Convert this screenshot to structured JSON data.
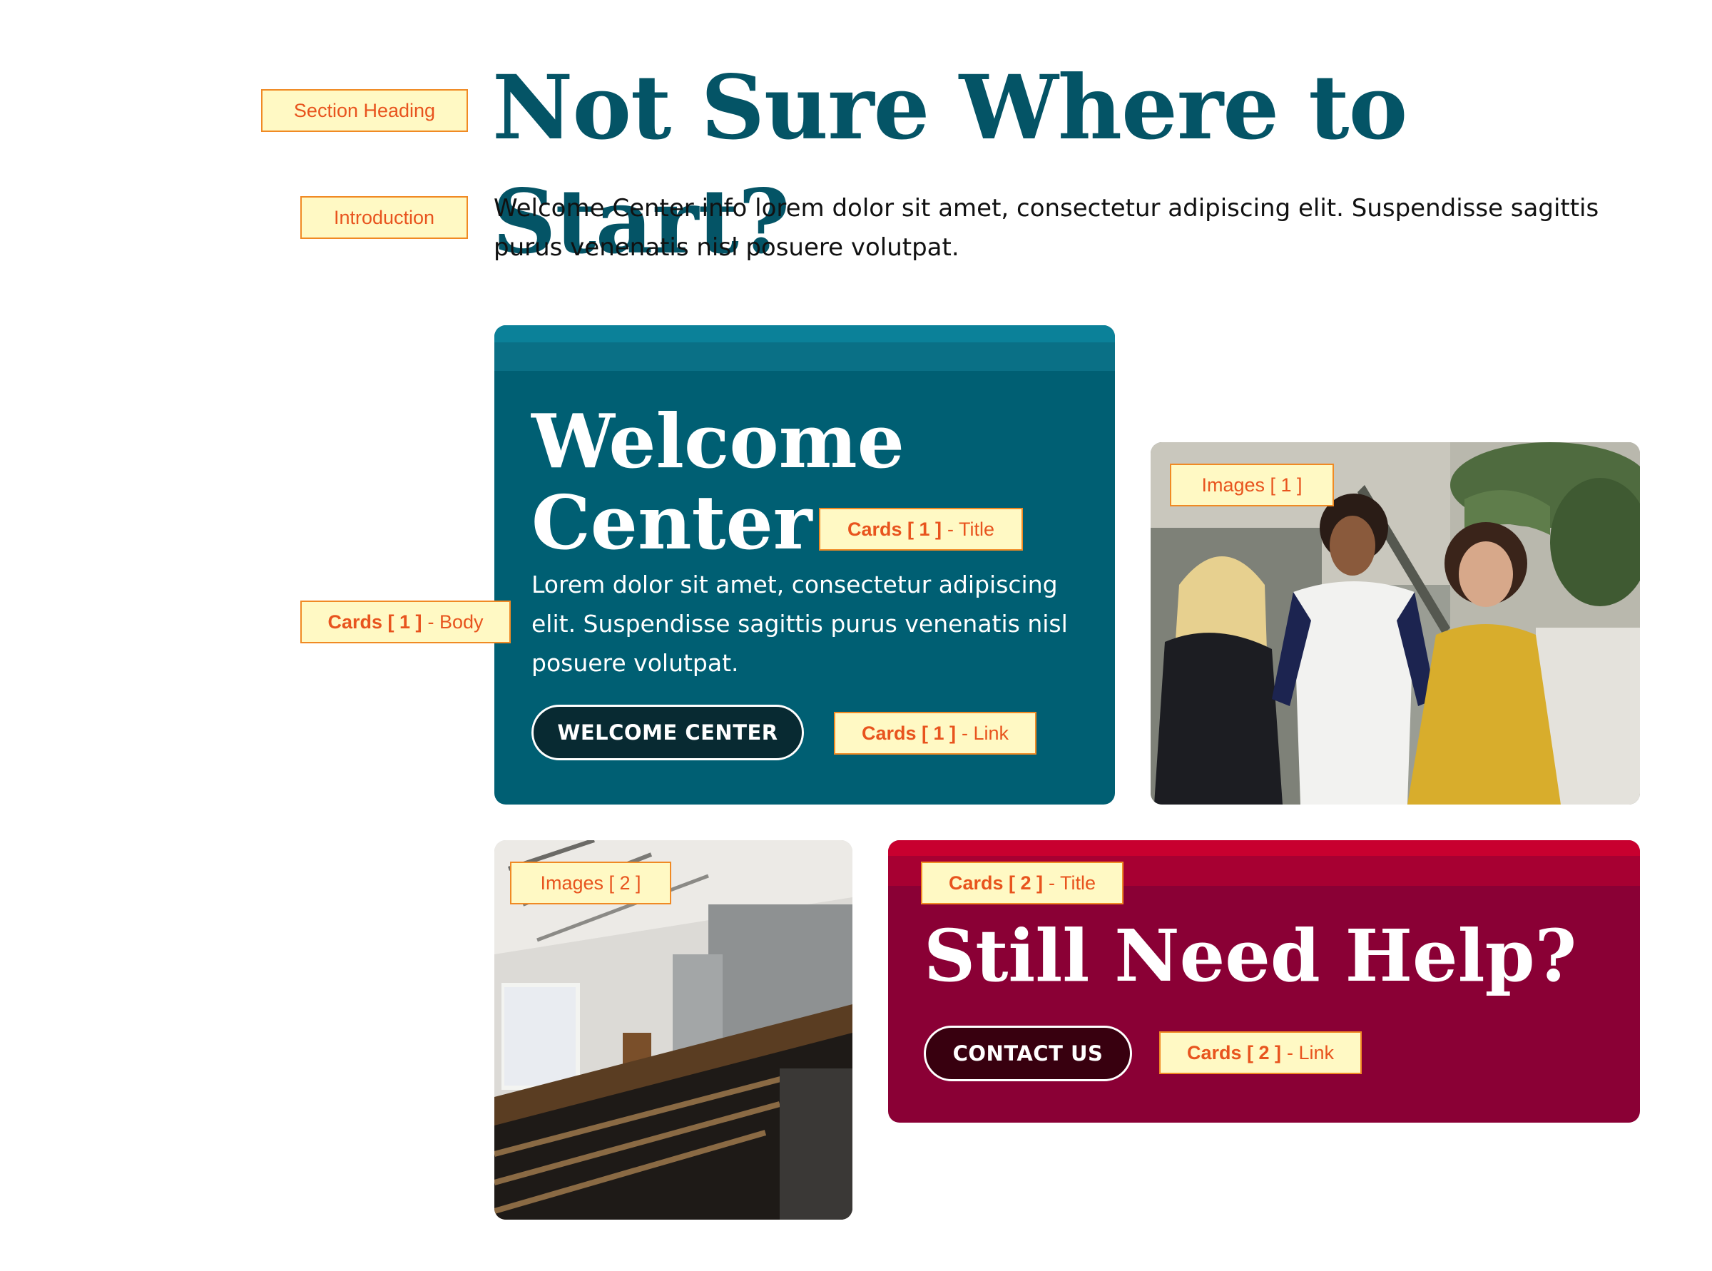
{
  "section": {
    "heading": "Not Sure Where to Start?",
    "intro": "Welcome Center info lorem dolor sit amet, consectetur adipiscing elit. Suspendisse sagittis purus venenatis nisl posuere volutpat."
  },
  "cards": [
    {
      "title": "Welcome Center",
      "body": "Lorem dolor sit amet, consectetur adipiscing elit. Suspendisse sagittis purus venenatis nisl posuere volutpat.",
      "link": "WELCOME CENTER"
    },
    {
      "title": "Still Need Help?",
      "link": "CONTACT US"
    }
  ],
  "annotations": {
    "section_heading": "Section Heading",
    "introduction": "Introduction",
    "card1_title_num": "Cards [ 1 ]",
    "card1_title_suffix": "- Title",
    "card1_body_num": "Cards [ 1 ]",
    "card1_body_suffix": "- Body",
    "card1_link_num": "Cards [ 1 ]",
    "card1_link_suffix": "- Link",
    "image1": "Images [ 1 ]",
    "image2": "Images [ 2 ]",
    "card2_title_num": "Cards [ 2 ]",
    "card2_title_suffix": "- Title",
    "card2_link_num": "Cards [ 2 ]",
    "card2_link_suffix": "- Link"
  },
  "colors": {
    "heading": "#045466",
    "card1_bg": "#005f73",
    "card2_bg": "#8a0035",
    "annotation_bg": "#fff9c4",
    "annotation_border": "#f08a24",
    "annotation_text": "#e8541e"
  }
}
